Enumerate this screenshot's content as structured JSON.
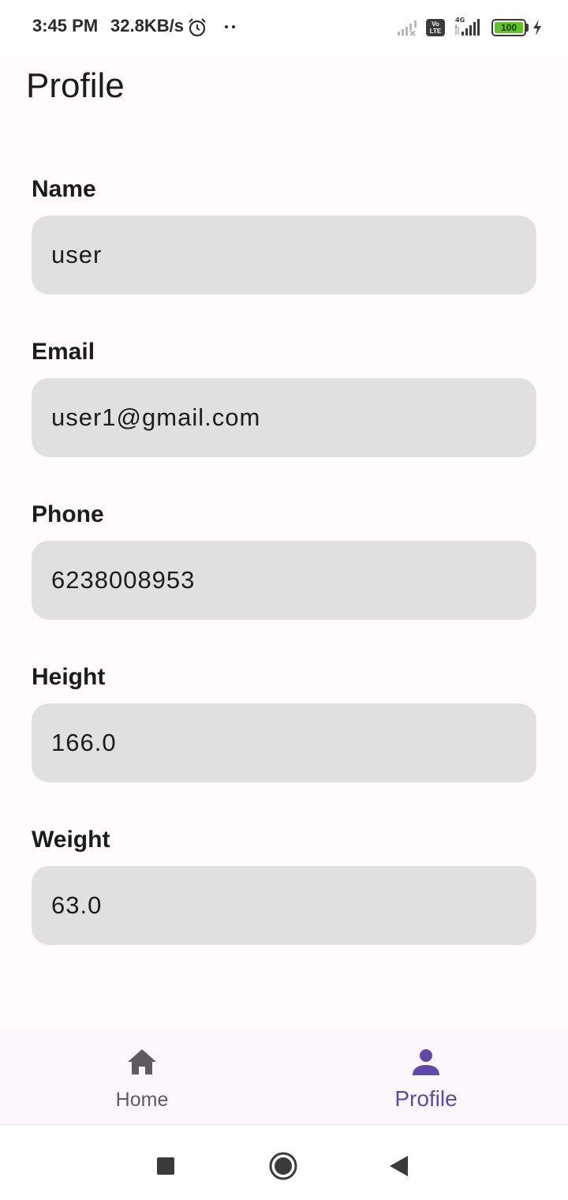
{
  "status_bar": {
    "time": "3:45 PM",
    "network_speed": "32.8KB/s",
    "volte_label_top": "Vo",
    "volte_label_bottom": "LTE",
    "network_type": "4G",
    "battery_level": "100"
  },
  "header": {
    "title": "Profile"
  },
  "form": {
    "fields": [
      {
        "label": "Name",
        "value": "user"
      },
      {
        "label": "Email",
        "value": "user1@gmail.com"
      },
      {
        "label": "Phone",
        "value": "6238008953"
      },
      {
        "label": "Height",
        "value": "166.0"
      },
      {
        "label": "Weight",
        "value": "63.0"
      }
    ]
  },
  "bottom_nav": {
    "items": [
      {
        "label": "Home",
        "icon": "home-icon",
        "selected": false
      },
      {
        "label": "Profile",
        "icon": "person-icon",
        "selected": true
      }
    ],
    "active_color": "#6048a8",
    "inactive_color": "#5d5a62"
  },
  "system_nav": {
    "icons": [
      "recents-square-icon",
      "home-circle-icon",
      "back-triangle-icon"
    ]
  }
}
